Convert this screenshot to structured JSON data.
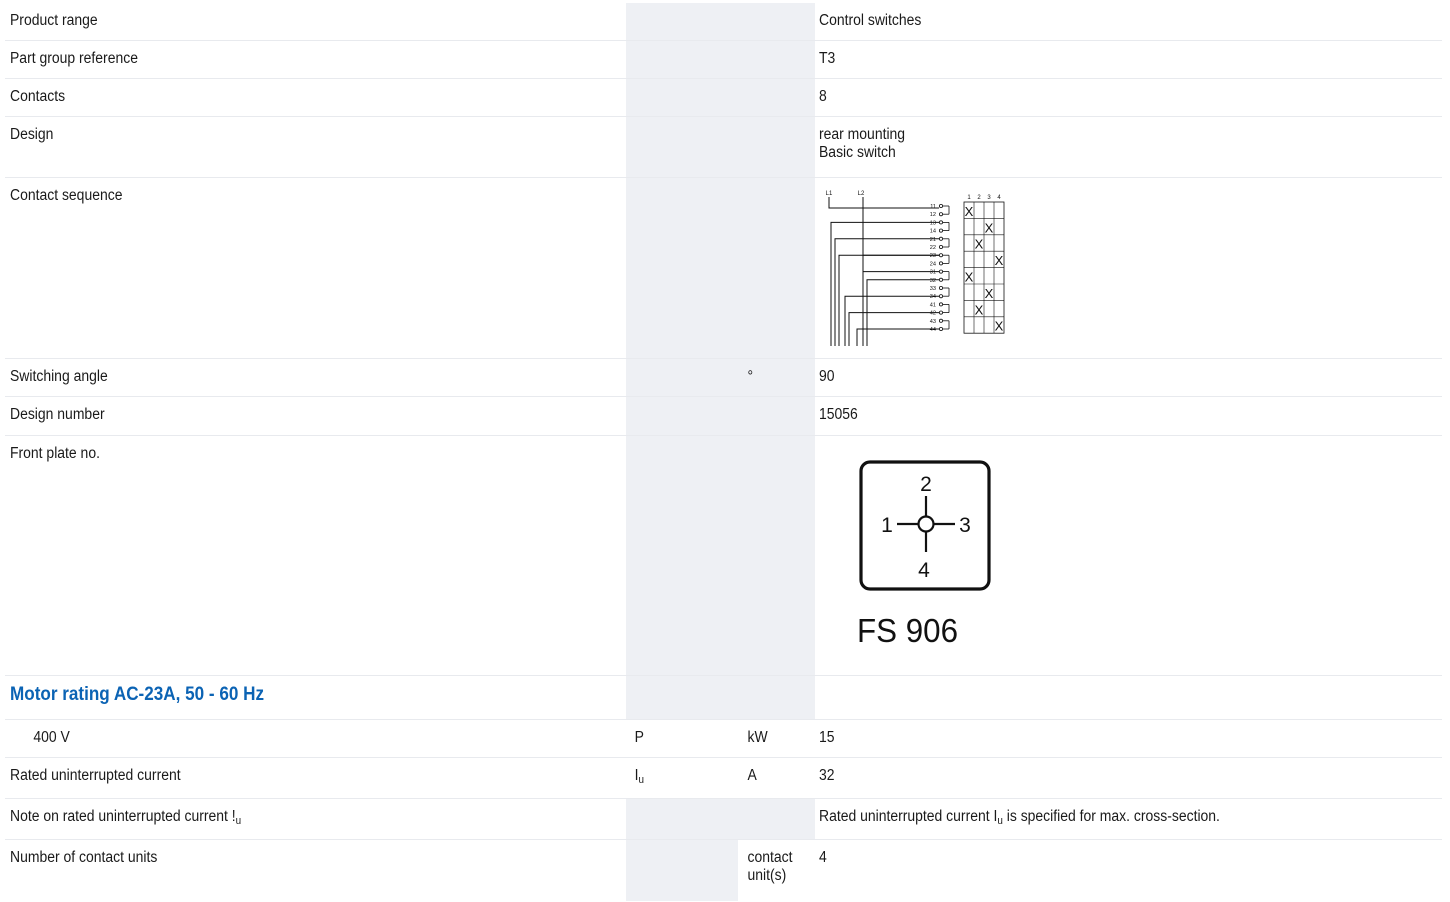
{
  "rows": {
    "product_range": {
      "label": "Product range",
      "value": "Control switches"
    },
    "part_group": {
      "label": "Part group reference",
      "value": "T3"
    },
    "contacts": {
      "label": "Contacts",
      "value": "8"
    },
    "design": {
      "label": "Design",
      "value_line1": "rear mounting",
      "value_line2": "Basic switch"
    },
    "contact_sequence": {
      "label": "Contact sequence",
      "diagram": {
        "inputs": [
          "L1",
          "L2"
        ],
        "positions": [
          "1",
          "2",
          "3",
          "4"
        ],
        "terminals": [
          "11",
          "12",
          "13",
          "14",
          "21",
          "22",
          "23",
          "24",
          "31",
          "32",
          "33",
          "34",
          "41",
          "42",
          "43",
          "44"
        ],
        "marker": "X"
      }
    },
    "switching_angle": {
      "label": "Switching angle",
      "unit": "°",
      "value": "90"
    },
    "design_number": {
      "label": "Design number",
      "value": "15056"
    },
    "front_plate": {
      "label": "Front plate no.",
      "plate": {
        "top": "2",
        "left": "1",
        "right": "3",
        "bottom": "4",
        "caption": "FS 906"
      }
    }
  },
  "section": {
    "title": "Motor rating AC-23A, 50 - 60 Hz"
  },
  "motor_rows": {
    "v400": {
      "label": "400 V",
      "symbol": "P",
      "unit": "kW",
      "value": "15"
    },
    "rated_current": {
      "label": "Rated uninterrupted current",
      "symbol": "I",
      "symbol_sub": "u",
      "unit": "A",
      "value": "32"
    },
    "note_current": {
      "label": "Note on rated uninterrupted current !",
      "label_sub": "u",
      "value_pre": "Rated uninterrupted current I",
      "value_sub": "u",
      "value_post": " is specified for max. cross-section."
    },
    "contact_units": {
      "label": "Number of contact units",
      "unit_line1": "contact",
      "unit_line2": "unit(s)",
      "value": "4"
    }
  },
  "colors": {
    "section_title": "#0b63b4",
    "shade": "#eef0f4",
    "divider": "#e8eaee"
  }
}
